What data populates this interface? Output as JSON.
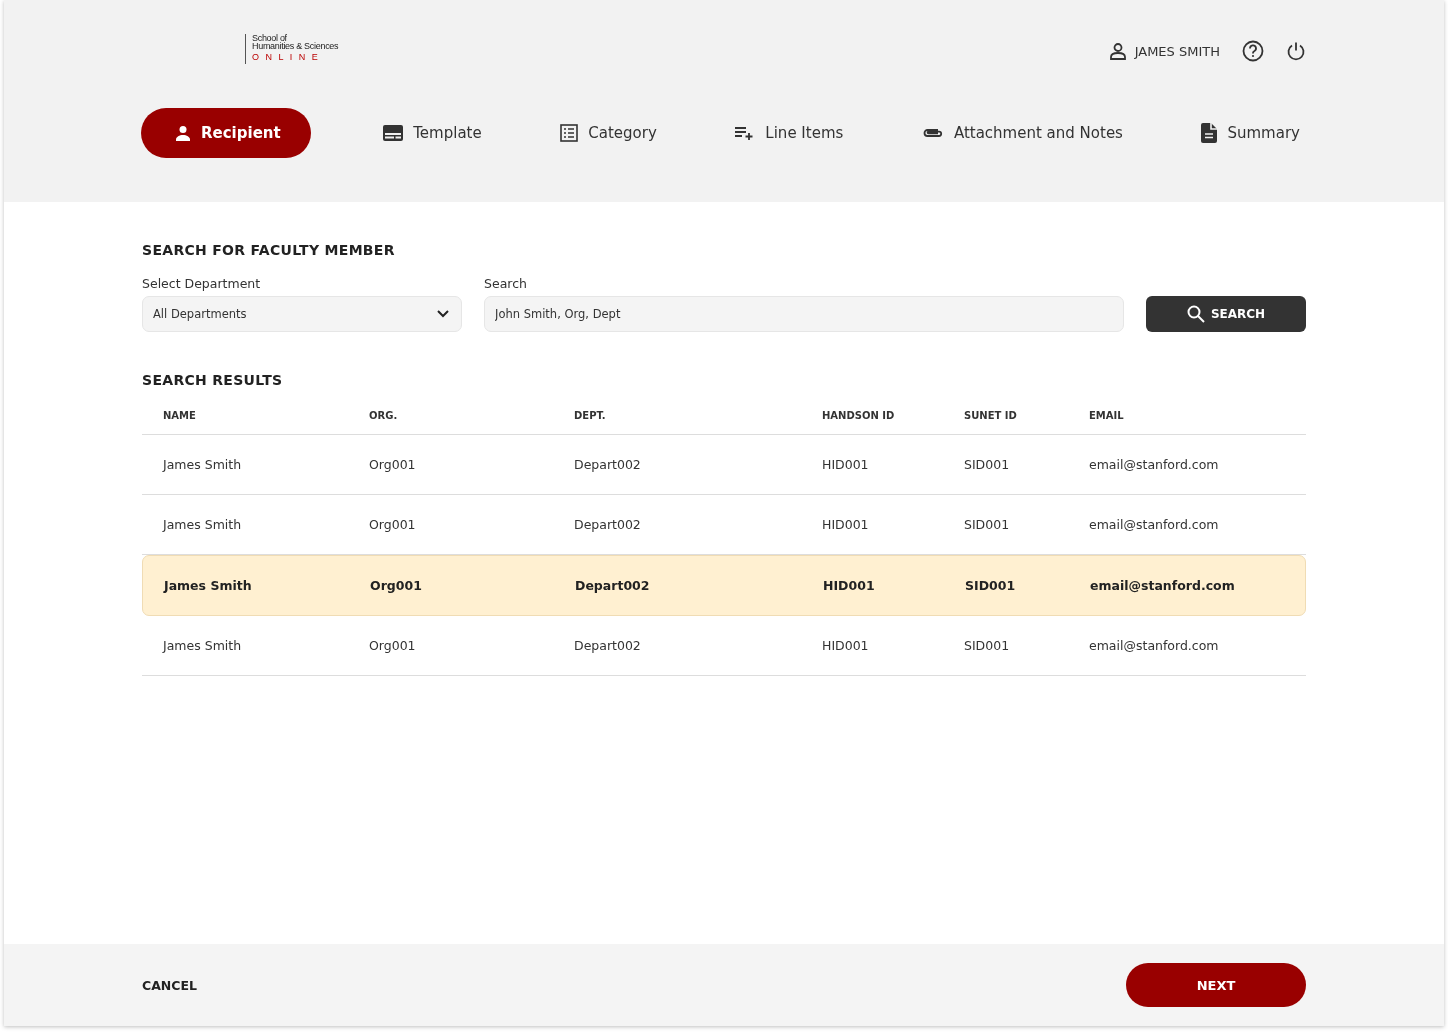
{
  "logo": {
    "line1": "School of",
    "line2": "Humanities & Sciences",
    "line3": "O N L I N E"
  },
  "user": {
    "name": "JAMES SMITH"
  },
  "steps": [
    {
      "kind": "person",
      "label": "Recipient",
      "selected": true
    },
    {
      "kind": "template",
      "label": "Template",
      "selected": false
    },
    {
      "kind": "list",
      "label": "Category",
      "selected": false
    },
    {
      "kind": "add",
      "label": "Line Items",
      "selected": false
    },
    {
      "kind": "clip",
      "label": "Attachment and Notes",
      "selected": false
    },
    {
      "kind": "doc",
      "label": "Summary",
      "selected": false
    }
  ],
  "search_section": {
    "title": "SEARCH FOR FACULTY MEMBER",
    "department_label": "Select Department",
    "department_value": "All Departments",
    "search_label": "Search",
    "search_value": "John Smith, Org, Dept",
    "button": "SEARCH"
  },
  "results": {
    "title": "SEARCH RESULTS",
    "columns": [
      "NAME",
      "ORG.",
      "DEPT.",
      "HANDSON ID",
      "SUNET ID",
      "EMAIL"
    ],
    "rows": [
      {
        "cells": [
          "James Smith",
          "Org001",
          "Depart002",
          "HID001",
          "SID001",
          "email@stanford.com"
        ],
        "selected": false
      },
      {
        "cells": [
          "James Smith",
          "Org001",
          "Depart002",
          "HID001",
          "SID001",
          "email@stanford.com"
        ],
        "selected": false
      },
      {
        "cells": [
          "James Smith",
          "Org001",
          "Depart002",
          "HID001",
          "SID001",
          "email@stanford.com"
        ],
        "selected": true
      },
      {
        "cells": [
          "James Smith",
          "Org001",
          "Depart002",
          "HID001",
          "SID001",
          "email@stanford.com"
        ],
        "selected": false
      }
    ]
  },
  "footer": {
    "cancel": "CANCEL",
    "next": "NEXT"
  }
}
